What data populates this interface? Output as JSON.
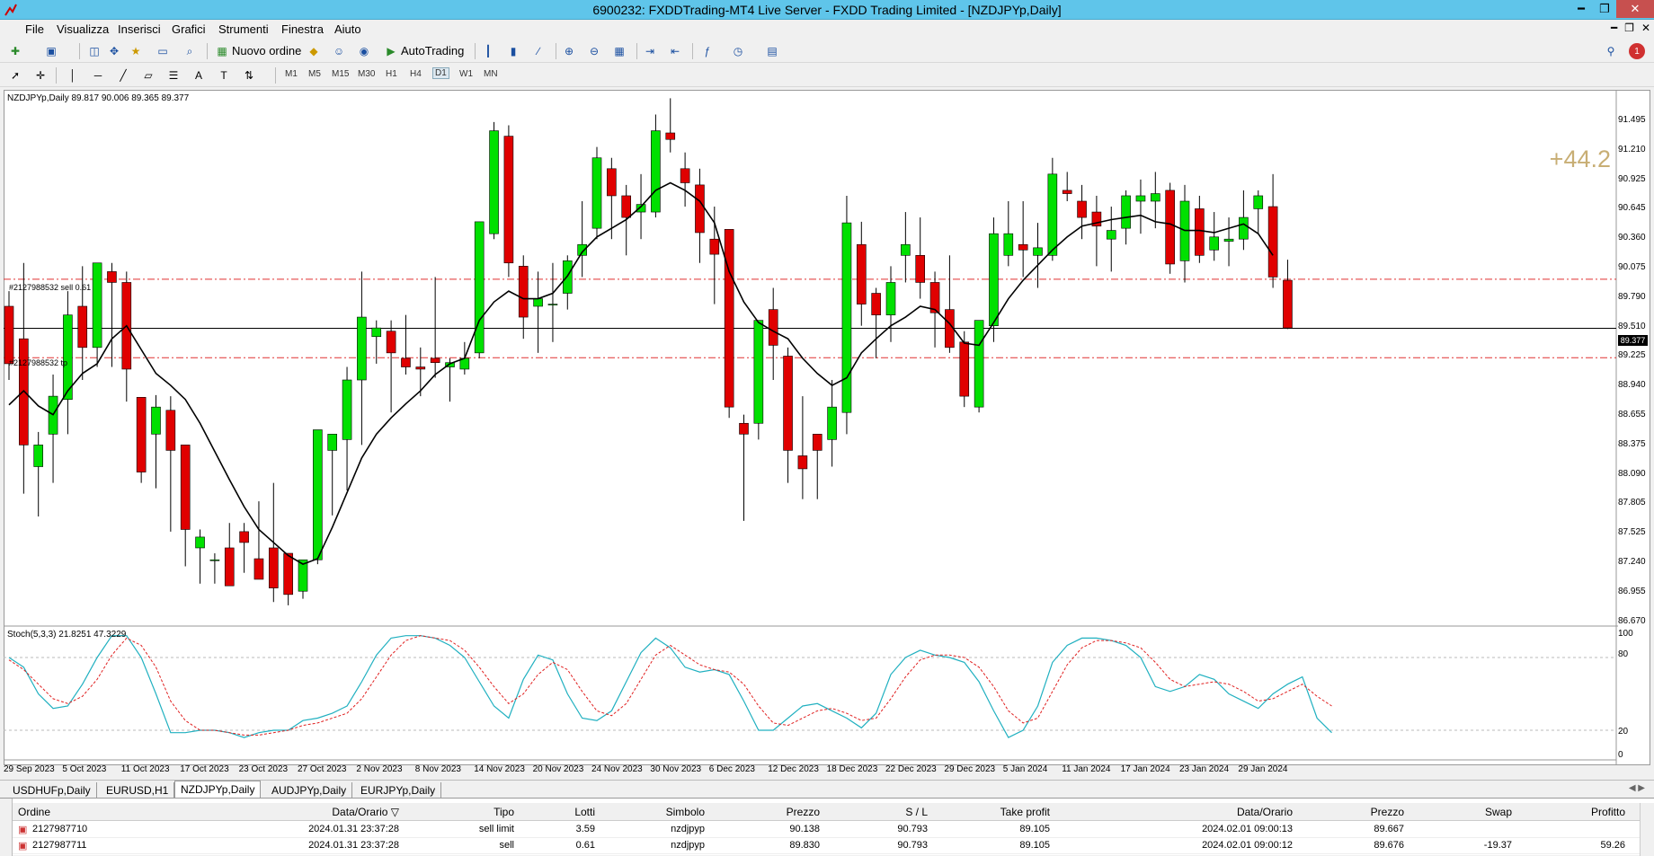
{
  "window": {
    "title": "6900232: FXDDTrading-MT4 Live Server - FXDD Trading Limited - [NZDJPYp,Daily]",
    "minimize": "━",
    "maximize": "❐",
    "close": "✕"
  },
  "menu": [
    "File",
    "Visualizza",
    "Inserisci",
    "Grafici",
    "Strumenti",
    "Finestra",
    "Aiuto"
  ],
  "toolbar": {
    "new_order": "Nuovo ordine",
    "autotrading": "AutoTrading",
    "alert_count": "1"
  },
  "timeframes": [
    "M1",
    "M5",
    "M15",
    "M30",
    "H1",
    "H4",
    "D1",
    "W1",
    "MN"
  ],
  "active_timeframe": "D1",
  "chart": {
    "header": "NZDJPYp,Daily  89.817 90.006 89.365 89.377",
    "profit": "+44.2",
    "current_price": "89.377",
    "order_sell_label": "#2127988532 sell 0.61",
    "order_tp_label": "#2127988532 tp",
    "price_labels": [
      "91.495",
      "91.210",
      "90.925",
      "90.645",
      "90.360",
      "90.075",
      "89.790",
      "89.510",
      "89.225",
      "88.940",
      "88.655",
      "88.375",
      "88.090",
      "87.805",
      "87.525",
      "87.240",
      "86.955",
      "86.670"
    ],
    "date_labels": [
      "29 Sep 2023",
      "5 Oct 2023",
      "11 Oct 2023",
      "17 Oct 2023",
      "23 Oct 2023",
      "27 Oct 2023",
      "2 Nov 2023",
      "8 Nov 2023",
      "14 Nov 2023",
      "20 Nov 2023",
      "24 Nov 2023",
      "30 Nov 2023",
      "6 Dec 2023",
      "12 Dec 2023",
      "18 Dec 2023",
      "22 Dec 2023",
      "29 Dec 2023",
      "5 Jan 2024",
      "11 Jan 2024",
      "17 Jan 2024",
      "23 Jan 2024",
      "29 Jan 2024"
    ],
    "stoch_header": "Stoch(5,3,3) 21.8251 47.3229",
    "stoch_labels": [
      "100",
      "80",
      "20",
      "0"
    ]
  },
  "chart_data": {
    "type": "candlestick",
    "symbol": "NZDJPYp",
    "timeframe": "Daily",
    "ylim": [
      86.67,
      91.495
    ],
    "candles": [
      [
        89.58,
        89.72,
        88.9,
        89.05
      ],
      [
        89.28,
        89.98,
        87.85,
        88.3
      ],
      [
        88.1,
        88.42,
        87.64,
        88.3
      ],
      [
        88.4,
        88.95,
        87.95,
        88.75
      ],
      [
        88.72,
        89.72,
        88.4,
        89.5
      ],
      [
        89.58,
        89.95,
        88.9,
        89.2
      ],
      [
        89.2,
        89.98,
        89.02,
        89.98
      ],
      [
        89.9,
        89.98,
        89.02,
        89.8
      ],
      [
        89.8,
        89.9,
        88.7,
        89.0
      ],
      [
        88.74,
        88.74,
        87.95,
        88.05
      ],
      [
        88.4,
        88.76,
        87.9,
        88.65
      ],
      [
        88.62,
        88.75,
        87.5,
        88.25
      ],
      [
        88.3,
        88.3,
        87.18,
        87.52
      ],
      [
        87.35,
        87.52,
        87.02,
        87.45
      ],
      [
        87.24,
        87.3,
        87.02,
        87.24
      ],
      [
        87.35,
        87.58,
        87.12,
        87.0
      ],
      [
        87.5,
        87.58,
        87.12,
        87.4
      ],
      [
        87.25,
        87.78,
        87.1,
        87.06
      ],
      [
        87.35,
        87.95,
        86.85,
        86.98
      ],
      [
        87.3,
        87.3,
        86.82,
        86.92
      ],
      [
        86.95,
        87.05,
        86.88,
        87.24
      ],
      [
        87.24,
        88.44,
        87.2,
        88.44
      ],
      [
        88.25,
        88.4,
        87.65,
        88.4
      ],
      [
        88.35,
        89.02,
        87.88,
        88.9
      ],
      [
        88.9,
        89.9,
        88.3,
        89.48
      ],
      [
        89.3,
        89.45,
        89.05,
        89.38
      ],
      [
        89.35,
        89.45,
        88.6,
        89.15
      ],
      [
        89.1,
        89.5,
        88.95,
        89.02
      ],
      [
        89.02,
        89.2,
        88.75,
        89.0
      ],
      [
        89.1,
        89.85,
        88.92,
        89.06
      ],
      [
        89.02,
        89.1,
        88.7,
        89.06
      ],
      [
        89.0,
        89.25,
        88.95,
        89.1
      ],
      [
        89.15,
        90.36,
        89.1,
        90.36
      ],
      [
        90.25,
        91.28,
        90.2,
        91.2
      ],
      [
        91.15,
        91.25,
        89.85,
        89.98
      ],
      [
        89.95,
        90.05,
        89.28,
        89.48
      ],
      [
        89.58,
        89.9,
        89.15,
        89.65
      ],
      [
        89.6,
        89.98,
        89.25,
        89.6
      ],
      [
        89.7,
        90.05,
        89.55,
        90.0
      ],
      [
        90.05,
        90.55,
        89.85,
        90.15
      ],
      [
        90.3,
        91.05,
        90.2,
        90.95
      ],
      [
        90.85,
        90.95,
        90.2,
        90.6
      ],
      [
        90.6,
        90.7,
        90.05,
        90.4
      ],
      [
        90.45,
        90.8,
        90.2,
        90.52
      ],
      [
        90.45,
        91.35,
        90.4,
        91.2
      ],
      [
        91.18,
        91.5,
        91.0,
        91.12
      ],
      [
        90.85,
        91.0,
        90.5,
        90.72
      ],
      [
        90.7,
        90.85,
        89.98,
        90.26
      ],
      [
        90.2,
        90.5,
        89.6,
        90.06
      ],
      [
        90.29,
        90.29,
        88.55,
        88.65
      ],
      [
        88.5,
        88.58,
        87.6,
        88.4
      ],
      [
        88.5,
        89.45,
        88.35,
        89.45
      ],
      [
        89.55,
        89.75,
        88.9,
        89.22
      ],
      [
        89.12,
        89.2,
        87.95,
        88.25
      ],
      [
        88.2,
        88.75,
        87.8,
        88.08
      ],
      [
        88.4,
        88.4,
        87.8,
        88.25
      ],
      [
        88.35,
        88.9,
        88.1,
        88.65
      ],
      [
        88.6,
        90.6,
        88.4,
        90.35
      ],
      [
        90.15,
        90.36,
        89.4,
        89.6
      ],
      [
        89.7,
        89.75,
        89.1,
        89.5
      ],
      [
        89.5,
        89.95,
        89.25,
        89.8
      ],
      [
        90.05,
        90.45,
        89.8,
        90.15
      ],
      [
        90.05,
        90.4,
        89.65,
        89.8
      ],
      [
        89.8,
        89.9,
        89.2,
        89.52
      ],
      [
        89.55,
        90.05,
        89.15,
        89.2
      ],
      [
        89.25,
        89.35,
        88.65,
        88.75
      ],
      [
        88.65,
        89.25,
        88.6,
        89.45
      ],
      [
        89.4,
        90.4,
        89.25,
        90.25
      ],
      [
        90.05,
        90.55,
        89.95,
        90.25
      ],
      [
        90.15,
        90.55,
        89.85,
        90.1
      ],
      [
        90.05,
        90.35,
        89.75,
        90.12
      ],
      [
        90.05,
        90.95,
        90.0,
        90.8
      ],
      [
        90.65,
        90.82,
        90.55,
        90.62
      ],
      [
        90.55,
        90.7,
        90.2,
        90.4
      ],
      [
        90.45,
        90.6,
        89.95,
        90.32
      ],
      [
        90.2,
        90.5,
        89.9,
        90.28
      ],
      [
        90.3,
        90.65,
        90.15,
        90.6
      ],
      [
        90.55,
        90.75,
        90.25,
        90.6
      ],
      [
        90.55,
        90.82,
        90.3,
        90.62
      ],
      [
        90.65,
        90.72,
        89.88,
        89.97
      ],
      [
        90.0,
        90.7,
        89.8,
        90.55
      ],
      [
        90.48,
        90.6,
        89.98,
        90.05
      ],
      [
        90.1,
        90.45,
        90.0,
        90.22
      ],
      [
        90.18,
        90.4,
        89.95,
        90.2
      ],
      [
        90.2,
        90.65,
        90.1,
        90.4
      ],
      [
        90.48,
        90.65,
        90.25,
        90.6
      ],
      [
        90.5,
        90.8,
        89.75,
        89.85
      ],
      [
        89.82,
        90.01,
        89.37,
        89.38
      ]
    ],
    "ma_line": [
      88.67,
      88.8,
      88.66,
      88.58,
      88.8,
      88.96,
      89.05,
      89.28,
      89.4,
      89.18,
      88.96,
      88.85,
      88.72,
      88.5,
      88.24,
      87.98,
      87.73,
      87.52,
      87.4,
      87.28,
      87.2,
      87.25,
      87.54,
      87.86,
      88.18,
      88.4,
      88.55,
      88.68,
      88.8,
      88.95,
      89.05,
      89.1,
      89.45,
      89.62,
      89.72,
      89.65,
      89.65,
      89.7,
      89.86,
      90.08,
      90.22,
      90.3,
      90.38,
      90.5,
      90.65,
      90.72,
      90.65,
      90.55,
      90.35,
      89.9,
      89.62,
      89.43,
      89.35,
      89.28,
      89.1,
      88.96,
      88.85,
      88.92,
      89.15,
      89.28,
      89.4,
      89.48,
      89.58,
      89.55,
      89.42,
      89.24,
      89.22,
      89.43,
      89.65,
      89.82,
      89.96,
      90.1,
      90.22,
      90.32,
      90.35,
      90.38,
      90.4,
      90.42,
      90.36,
      90.34,
      90.28,
      90.28,
      90.26,
      90.3,
      90.34,
      90.25,
      90.05
    ],
    "sell_line": 89.83,
    "tp_line": 89.105,
    "current_price": 89.377,
    "stoch_main": [
      80,
      72,
      50,
      38,
      40,
      58,
      80,
      98,
      98,
      80,
      50,
      18,
      18,
      20,
      20,
      18,
      14,
      18,
      20,
      20,
      28,
      30,
      34,
      40,
      60,
      82,
      96,
      98,
      98,
      96,
      90,
      80,
      60,
      40,
      30,
      62,
      82,
      78,
      50,
      30,
      28,
      36,
      60,
      84,
      96,
      88,
      72,
      68,
      70,
      66,
      44,
      20,
      20,
      30,
      40,
      42,
      36,
      30,
      22,
      34,
      66,
      80,
      86,
      82,
      80,
      76,
      60,
      36,
      14,
      20,
      40,
      76,
      90,
      96,
      96,
      94,
      90,
      80,
      56,
      52,
      56,
      66,
      62,
      50,
      44,
      38,
      50,
      58,
      64,
      30,
      18
    ],
    "stoch_signal": [
      78,
      70,
      58,
      46,
      42,
      48,
      62,
      82,
      96,
      90,
      72,
      44,
      28,
      20,
      20,
      18,
      16,
      16,
      18,
      20,
      24,
      26,
      30,
      34,
      46,
      64,
      82,
      94,
      98,
      96,
      94,
      86,
      72,
      56,
      42,
      50,
      66,
      76,
      70,
      52,
      36,
      32,
      42,
      62,
      82,
      90,
      82,
      74,
      70,
      68,
      58,
      40,
      26,
      24,
      30,
      36,
      38,
      34,
      28,
      30,
      46,
      64,
      78,
      82,
      82,
      80,
      72,
      56,
      36,
      26,
      30,
      52,
      74,
      88,
      94,
      94,
      92,
      88,
      76,
      62,
      56,
      58,
      60,
      58,
      52,
      44,
      46,
      52,
      58,
      48,
      40
    ]
  },
  "tabs": [
    "USDHUFp,Daily",
    "EURUSD,H1",
    "NZDJPYp,Daily",
    "AUDJPYp,Daily",
    "EURJPYp,Daily"
  ],
  "active_tab": "NZDJPYp,Daily",
  "orders": {
    "headers": [
      "Ordine",
      "Data/Orario",
      "Tipo",
      "Lotti",
      "Simbolo",
      "Prezzo",
      "S / L",
      "Take profit",
      "Data/Orario",
      "Prezzo",
      "Swap",
      "Profitto"
    ],
    "rows": [
      [
        "2127987710",
        "2024.01.31 23:37:28",
        "sell limit",
        "3.59",
        "nzdjpyp",
        "90.138",
        "90.793",
        "89.105",
        "2024.02.01 09:00:13",
        "89.667",
        "",
        ""
      ],
      [
        "2127987711",
        "2024.01.31 23:37:28",
        "sell",
        "0.61",
        "nzdjpyp",
        "89.830",
        "90.793",
        "89.105",
        "2024.02.01 09:00:12",
        "89.676",
        "-19.37",
        "59.26"
      ]
    ]
  }
}
